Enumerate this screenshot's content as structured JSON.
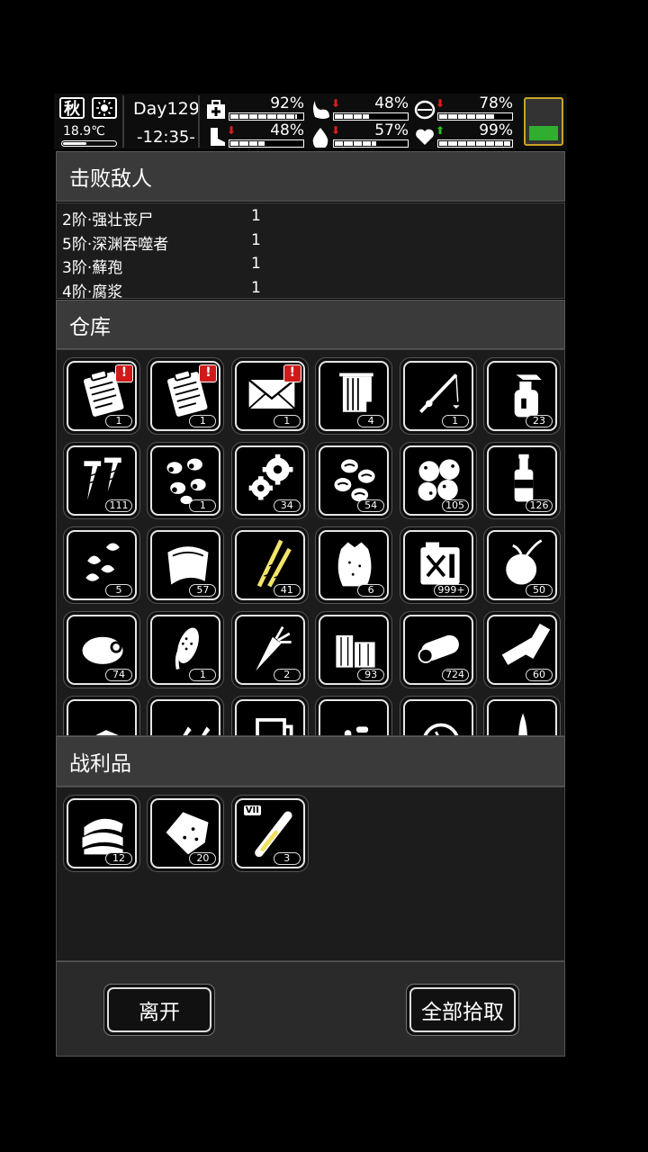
{
  "status": {
    "season": "秋",
    "weather_icon": "sun-icon",
    "temperature": "18.9℃",
    "day": "Day129",
    "clock": "-12:35-",
    "stats": [
      {
        "name": "health",
        "icon": "medkit-icon",
        "value": "92%",
        "fill": 0.92,
        "trend": ""
      },
      {
        "name": "hunger",
        "icon": "stomach-icon",
        "value": "48%",
        "fill": 0.48,
        "trend": "down"
      },
      {
        "name": "mood",
        "icon": "brain-icon",
        "value": "78%",
        "fill": 0.78,
        "trend": "down"
      },
      {
        "name": "stamina",
        "icon": "boot-icon",
        "value": "48%",
        "fill": 0.48,
        "trend": "down"
      },
      {
        "name": "thirst",
        "icon": "water-drop-icon",
        "value": "57%",
        "fill": 0.57,
        "trend": "down"
      },
      {
        "name": "spirit",
        "icon": "heart-icon",
        "value": "99%",
        "fill": 0.99,
        "trend": "up"
      }
    ],
    "battery_level": 0.35,
    "trend_colors": {
      "down": "#e01b1b",
      "up": "#27c027"
    }
  },
  "enemies": {
    "title": "击败敌人",
    "rows": [
      {
        "name": "2阶·强壮丧尸",
        "count": "1"
      },
      {
        "name": "5阶·深渊吞噬者",
        "count": "1"
      },
      {
        "name": "3阶·蘚孢",
        "count": "1"
      },
      {
        "name": "4阶·腐浆",
        "count": "1"
      }
    ]
  },
  "warehouse": {
    "title": "仓库",
    "items": [
      {
        "icon": "clipboard-icon",
        "count": "1",
        "alert": "!"
      },
      {
        "icon": "clipboard-icon",
        "count": "1",
        "alert": "!"
      },
      {
        "icon": "envelope-icon",
        "count": "1",
        "alert": "!"
      },
      {
        "icon": "towel-rack-icon",
        "count": "4",
        "alert": ""
      },
      {
        "icon": "fishing-rod-icon",
        "count": "1",
        "alert": ""
      },
      {
        "icon": "spray-bottle-icon",
        "count": "23",
        "alert": ""
      },
      {
        "icon": "screws-icon",
        "count": "111",
        "alert": ""
      },
      {
        "icon": "seeds-icon",
        "count": "1",
        "alert": ""
      },
      {
        "icon": "gears-icon",
        "count": "34",
        "alert": ""
      },
      {
        "icon": "beans-icon",
        "count": "54",
        "alert": ""
      },
      {
        "icon": "potatoes-icon",
        "count": "105",
        "alert": ""
      },
      {
        "icon": "bottle-icon",
        "count": "126",
        "alert": ""
      },
      {
        "icon": "sunflower-seeds-icon",
        "count": "5",
        "alert": ""
      },
      {
        "icon": "cloth-icon",
        "count": "57",
        "alert": ""
      },
      {
        "icon": "wheat-icon",
        "count": "41",
        "alert": ""
      },
      {
        "icon": "sack-icon",
        "count": "6",
        "alert": ""
      },
      {
        "icon": "fuel-can-icon",
        "count": "999+",
        "alert": ""
      },
      {
        "icon": "onion-icon",
        "count": "50",
        "alert": ""
      },
      {
        "icon": "meat-icon",
        "count": "74",
        "alert": ""
      },
      {
        "icon": "corn-icon",
        "count": "1",
        "alert": ""
      },
      {
        "icon": "carrot-icon",
        "count": "2",
        "alert": ""
      },
      {
        "icon": "wood-icon",
        "count": "93",
        "alert": ""
      },
      {
        "icon": "log-icon",
        "count": "724",
        "alert": ""
      },
      {
        "icon": "battery-icon",
        "count": "60",
        "alert": ""
      },
      {
        "icon": "paper-icon",
        "count": "",
        "alert": ""
      },
      {
        "icon": "bullets-icon",
        "count": "",
        "alert": ""
      },
      {
        "icon": "beaker-icon",
        "count": "",
        "alert": ""
      },
      {
        "icon": "pills-icon",
        "count": "",
        "alert": ""
      },
      {
        "icon": "turbine-icon",
        "count": "",
        "alert": ""
      },
      {
        "icon": "knife-icon",
        "count": "",
        "alert": ""
      }
    ]
  },
  "loot": {
    "title": "战利品",
    "items": [
      {
        "icon": "folded-cloth-icon",
        "count": "12"
      },
      {
        "icon": "meat-chunk-icon",
        "count": "20"
      },
      {
        "icon": "test-tube-icon",
        "count": "3",
        "tag": "VII"
      }
    ]
  },
  "buttons": {
    "leave": "离开",
    "take_all": "全部拾取"
  }
}
